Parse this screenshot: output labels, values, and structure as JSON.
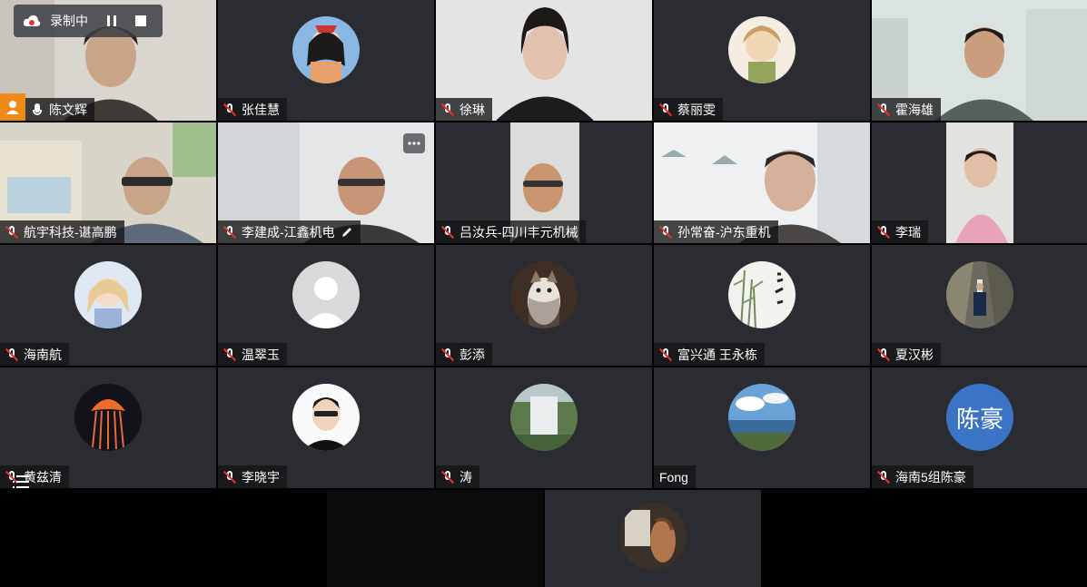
{
  "recording": {
    "status_label": "录制中"
  },
  "tiles": [
    {
      "name": "陈文辉",
      "mic": "on",
      "host": true,
      "kind": "video"
    },
    {
      "name": "张佳慧",
      "mic": "muted",
      "kind": "avatar"
    },
    {
      "name": "徐琳",
      "mic": "muted",
      "kind": "video"
    },
    {
      "name": "蔡丽雯",
      "mic": "muted",
      "kind": "avatar"
    },
    {
      "name": "霍海雄",
      "mic": "muted",
      "kind": "video"
    },
    {
      "name": "航宇科技-谌高鹏",
      "mic": "muted",
      "kind": "video"
    },
    {
      "name": "李建成-江鑫机电",
      "mic": "muted",
      "kind": "video",
      "editing": true
    },
    {
      "name": "吕汝兵-四川丰元机械",
      "mic": "muted",
      "kind": "video"
    },
    {
      "name": "孙常奋-沪东重机",
      "mic": "muted",
      "kind": "video"
    },
    {
      "name": "李瑞",
      "mic": "muted",
      "kind": "video"
    },
    {
      "name": "海南航",
      "mic": "muted",
      "kind": "avatar"
    },
    {
      "name": "温翠玉",
      "mic": "muted",
      "kind": "avatar"
    },
    {
      "name": "彭添",
      "mic": "muted",
      "kind": "avatar"
    },
    {
      "name": "富兴通 王永栋",
      "mic": "muted",
      "kind": "avatar"
    },
    {
      "name": "夏汉彬",
      "mic": "muted",
      "kind": "avatar"
    },
    {
      "name": "黄兹清",
      "mic": "muted",
      "kind": "avatar"
    },
    {
      "name": "李晓宇",
      "mic": "muted",
      "kind": "avatar"
    },
    {
      "name": "涛",
      "mic": "muted",
      "kind": "avatar"
    },
    {
      "name": "Fong",
      "mic": "none",
      "kind": "avatar"
    },
    {
      "name": "海南5组陈豪",
      "mic": "muted",
      "kind": "avatar",
      "avatar_text": "陈豪",
      "avatar_color": "#3b74c6"
    }
  ],
  "colors": {
    "tile_bg": "#2a2c31",
    "host_badge": "#f08a16",
    "muted_slash": "#e2362f"
  }
}
